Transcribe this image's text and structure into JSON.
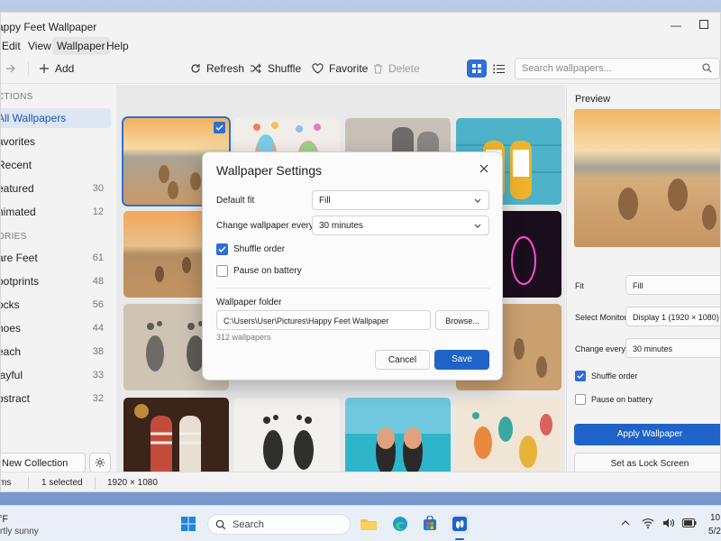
{
  "window": {
    "title": "appy Feet Wallpaper",
    "menu": [
      "Edit",
      "View",
      "Wallpaper",
      "Help"
    ],
    "active_menu": "Wallpaper"
  },
  "toolbar": {
    "add_label": "Add",
    "refresh_label": "Refresh",
    "shuffle_label": "Shuffle",
    "favorite_label": "Favorite",
    "delete_label": "Delete",
    "search_placeholder": "Search wallpapers..."
  },
  "sidebar": {
    "section1": "ctions",
    "items1": [
      {
        "label": "All Wallpapers",
        "active": true
      },
      {
        "label": "avorites"
      },
      {
        "label": "Recent"
      },
      {
        "label": "eatured",
        "count": "30"
      },
      {
        "label": "nimated",
        "count": "12"
      }
    ],
    "section2": "ories",
    "items2": [
      {
        "label": "are Feet",
        "count": "61"
      },
      {
        "label": "ootprints",
        "count": "48"
      },
      {
        "label": "ocks",
        "count": "56"
      },
      {
        "label": "hoes",
        "count": "44"
      },
      {
        "label": "each",
        "count": "38"
      },
      {
        "label": "layful",
        "count": "33"
      },
      {
        "label": "bstract",
        "count": "32"
      }
    ],
    "new_collection": "New Collection"
  },
  "grid": {
    "thumbnails": [
      "sunset-beach-footprints",
      "watercolor-footprints",
      "wool-socks-cozy",
      "yellow-sneakers-teal",
      "sunset-beach-footprints-2",
      "footprints-sand",
      "pebble-footprints-sand",
      "neon-footprint-heart",
      "pebble-footprints",
      "stone-footprints",
      "beach-footprints-surf",
      "sand-footprints-shore",
      "christmas-socks-fireplace",
      "ink-footprints",
      "flip-flops-beach",
      "colorful-abstract-footprints"
    ]
  },
  "preview": {
    "title": "Preview",
    "fit_label": "Fit",
    "fit_value": "Fill",
    "monitor_label": "Select Monitor",
    "monitor_value": "Display 1 (1920 × 1080)",
    "change_label": "Change every",
    "change_value": "30 minutes",
    "shuffle_label": "Shuffle order",
    "shuffle_checked": true,
    "battery_label": "Pause on battery",
    "battery_checked": false,
    "apply_label": "Apply Wallpaper",
    "lock_label": "Set as Lock Screen"
  },
  "status": {
    "items": "ms",
    "selected": "1 selected",
    "resolution": "1920 × 1080"
  },
  "dialog": {
    "title": "Wallpaper Settings",
    "fit_label": "Default fit",
    "fit_value": "Fill",
    "change_label": "Change wallpaper every",
    "change_value": "30 minutes",
    "shuffle_label": "Shuffle order",
    "shuffle_checked": true,
    "battery_label": "Pause on battery",
    "battery_checked": false,
    "folder_label": "Wallpaper folder",
    "folder_path": "C:\\Users\\User\\Pictures\\Happy Feet Wallpaper",
    "browse_label": "Browse...",
    "count_text": "312 wallpapers",
    "cancel_label": "Cancel",
    "save_label": "Save"
  },
  "taskbar": {
    "weather_temp": "°F",
    "weather_desc": "rtly sunny",
    "search_label": "Search",
    "clock_time": "10",
    "clock_date": "5/2"
  },
  "colors": {
    "accent": "#1f63c8",
    "selection": "#2d6fd6"
  }
}
